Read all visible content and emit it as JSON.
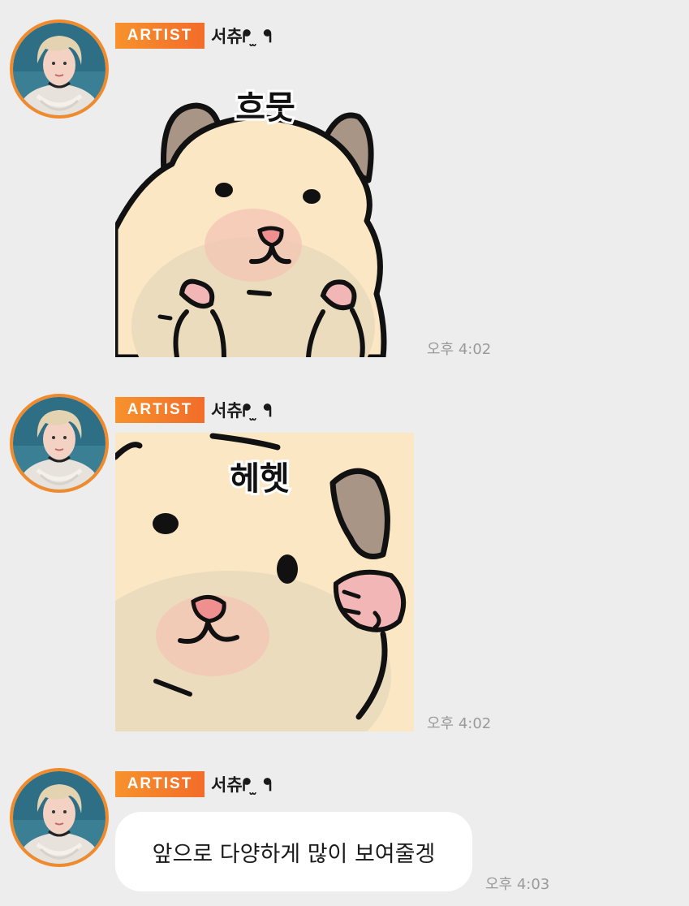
{
  "sender": {
    "badge": "ARTIST",
    "name": "서츄ᖰ ̫ ᖳ"
  },
  "messages": [
    {
      "type": "sticker",
      "sticker_text": "흐뭇",
      "time": "오후 4:02"
    },
    {
      "type": "sticker",
      "sticker_text": "헤헷",
      "time": "오후 4:02"
    },
    {
      "type": "text",
      "text": "앞으로 다양하게 많이 보여줄겡",
      "time": "오후 4:03"
    }
  ],
  "colors": {
    "background": "#ededed",
    "badge_orange": "#f58a2b",
    "avatar_ring": "#f08a2b",
    "bubble": "#ffffff",
    "time_text": "#9a9a9a"
  }
}
